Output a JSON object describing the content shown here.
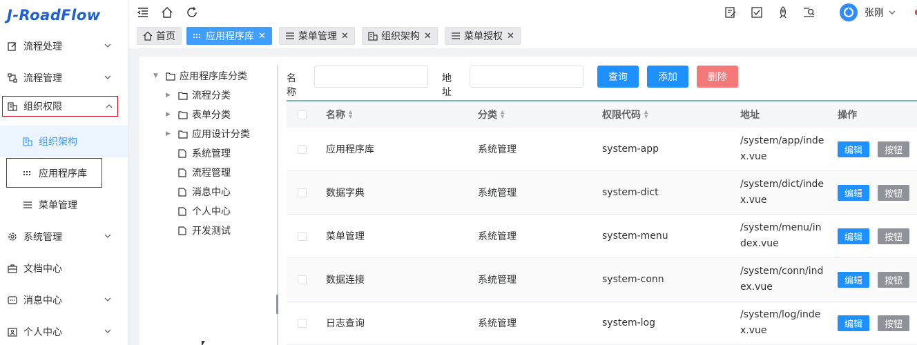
{
  "app": {
    "logo": "J-RoadFlow"
  },
  "sidebar": {
    "items": [
      {
        "label": "流程处理",
        "icon": "edit-icon"
      },
      {
        "label": "流程管理",
        "icon": "flow-icon"
      },
      {
        "label": "组织权限",
        "icon": "org-icon"
      },
      {
        "label": "组织架构",
        "icon": "org-icon"
      },
      {
        "label": "应用程序库",
        "icon": "grid-dots-icon"
      },
      {
        "label": "菜单管理",
        "icon": "menu-lines-icon"
      },
      {
        "label": "系统管理",
        "icon": "gear-icon"
      },
      {
        "label": "文档中心",
        "icon": "briefcase-icon"
      },
      {
        "label": "消息中心",
        "icon": "message-icon"
      },
      {
        "label": "个人中心",
        "icon": "id-card-icon"
      }
    ]
  },
  "header": {
    "user_name": "张刚"
  },
  "tabs": [
    {
      "label": "首页"
    },
    {
      "label": "应用程序库"
    },
    {
      "label": "菜单管理"
    },
    {
      "label": "组织架构"
    },
    {
      "label": "菜单授权"
    }
  ],
  "tree": {
    "root": "应用程序库分类",
    "nodes": [
      {
        "label": "流程分类"
      },
      {
        "label": "表单分类"
      },
      {
        "label": "应用设计分类"
      },
      {
        "label": "系统管理"
      },
      {
        "label": "流程管理"
      },
      {
        "label": "消息中心"
      },
      {
        "label": "个人中心"
      },
      {
        "label": "开发测试"
      }
    ]
  },
  "search": {
    "name_label": "名称",
    "name_value": "",
    "addr_label": "地址",
    "addr_value": "",
    "query_label": "查询",
    "add_label": "添加",
    "delete_label": "删除"
  },
  "table": {
    "headers": {
      "name": "名称",
      "category": "分类",
      "code": "权限代码",
      "address": "地址",
      "action": "操作"
    },
    "edit_label": "编辑",
    "button_label": "按钮",
    "rows": [
      {
        "name": "应用程序库",
        "category": "系统管理",
        "code": "system-app",
        "address": "/system/app/index.vue"
      },
      {
        "name": "数据字典",
        "category": "系统管理",
        "code": "system-dict",
        "address": "/system/dict/index.vue"
      },
      {
        "name": "菜单管理",
        "category": "系统管理",
        "code": "system-menu",
        "address": "/system/menu/index.vue"
      },
      {
        "name": "数据连接",
        "category": "系统管理",
        "code": "system-conn",
        "address": "/system/conn/index.vue"
      },
      {
        "name": "日志查询",
        "category": "系统管理",
        "code": "system-log",
        "address": "/system/log/index.vue"
      }
    ]
  }
}
